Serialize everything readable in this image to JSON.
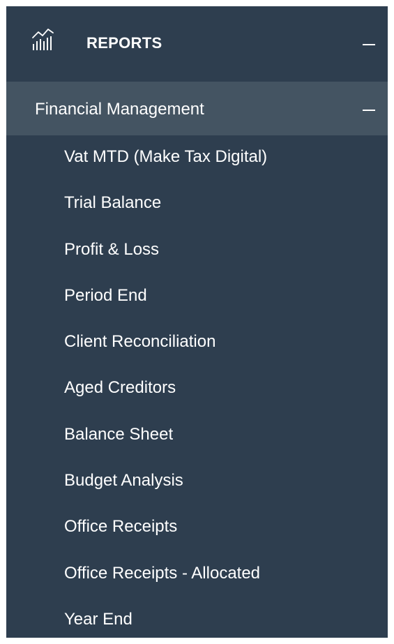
{
  "colors": {
    "sidebar_bg": "#2e3e4f",
    "active_group_bg": "#445462",
    "text": "#ffffff"
  },
  "section": {
    "icon": "analytics-chart-icon",
    "title": "REPORTS",
    "collapse_icon": "minus-icon"
  },
  "group": {
    "title": "Financial Management",
    "collapse_icon": "minus-icon"
  },
  "items": [
    {
      "label": "Vat MTD (Make Tax Digital)"
    },
    {
      "label": "Trial Balance"
    },
    {
      "label": "Profit & Loss"
    },
    {
      "label": "Period End"
    },
    {
      "label": "Client Reconciliation"
    },
    {
      "label": "Aged Creditors"
    },
    {
      "label": "Balance Sheet"
    },
    {
      "label": "Budget Analysis"
    },
    {
      "label": "Office Receipts"
    },
    {
      "label": "Office Receipts - Allocated"
    },
    {
      "label": "Year End"
    }
  ]
}
